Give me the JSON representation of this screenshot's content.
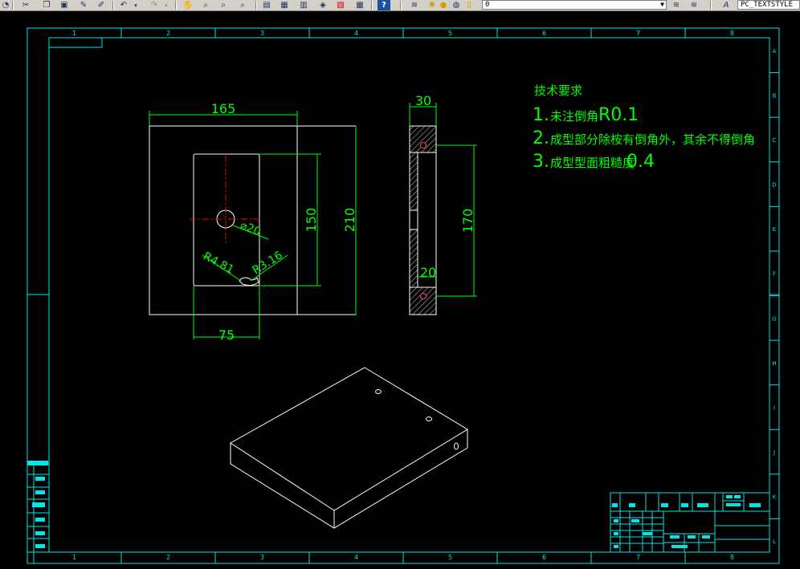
{
  "toolbar": {
    "layer_value": "0",
    "textstyle_value": "PC_TEXTSTYLE",
    "icons": [
      "measure-icon",
      "cut-icon",
      "copy-icon",
      "paste-icon",
      "match-properties-icon",
      "brush-icon",
      "undo-icon",
      "redo-icon",
      "pan-icon",
      "zoom-realtime-icon",
      "zoom-window-icon",
      "zoom-previous-icon",
      "properties-icon",
      "design-center-icon",
      "tool-palettes-icon",
      "sheet-set-icon",
      "markup-icon",
      "calculator-icon",
      "help-icon",
      "layer-manager-icon",
      "layer-state-icon",
      "layer-prev-icon",
      "text-style-icon"
    ]
  },
  "frame": {
    "col_labels": [
      "1",
      "2",
      "3",
      "4",
      "5",
      "6",
      "7",
      "8"
    ],
    "row_labels": [
      "A",
      "B",
      "C",
      "D",
      "E",
      "F",
      "G",
      "H",
      "I",
      "J",
      "K",
      "L"
    ]
  },
  "tech_requirements": {
    "title": "技术要求",
    "line1_prefix": "1.",
    "line1_cn": "未注倒角",
    "line1_val": "R0.1",
    "line2_prefix": "2.",
    "line2_cn": "成型部分除桉有倒角外，其余不得倒角",
    "line3_prefix": "3.",
    "line3_cn": "成型型面粗糙度",
    "line3_val": "0.4"
  },
  "dimensions": {
    "front_width": "165",
    "front_height": "210",
    "cavity_height": "150",
    "cavity_width": "75",
    "hole_dia": "⌀20",
    "radius_1": "R4.81",
    "radius_2": "R3.16",
    "side_width": "30",
    "side_height": "170",
    "side_small": "20"
  },
  "colors": {
    "frame": "#00e6e6",
    "geometry": "#ffffff",
    "dimension": "#00ff00",
    "centerline": "#ff0000"
  }
}
